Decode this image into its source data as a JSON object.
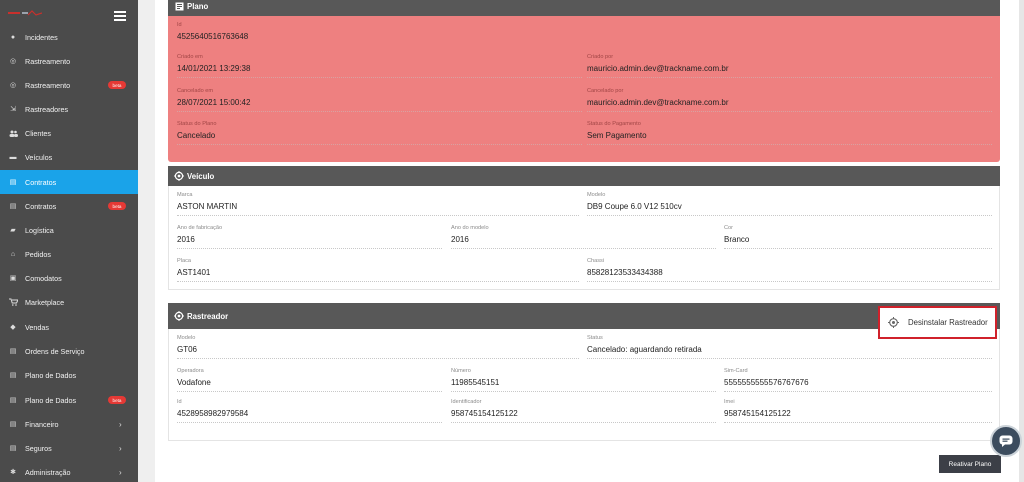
{
  "sidebar": {
    "items": [
      {
        "label": "Incidentes",
        "icon": "alert-icon",
        "glyph": "●"
      },
      {
        "label": "Rastreamento",
        "icon": "target-icon",
        "glyph": "◎"
      },
      {
        "label": "Rastreamento",
        "icon": "target-icon",
        "glyph": "◎",
        "badge": "beta"
      },
      {
        "label": "Rastreadores",
        "icon": "signin-icon",
        "glyph": "⇲"
      },
      {
        "label": "Clientes",
        "icon": "users-icon",
        "glyph": "👥"
      },
      {
        "label": "Veículos",
        "icon": "car-icon",
        "glyph": "▬"
      },
      {
        "label": "Contratos",
        "icon": "document-icon",
        "glyph": "▤",
        "active": true
      },
      {
        "label": "Contratos",
        "icon": "document-icon",
        "glyph": "▤",
        "badge": "beta"
      },
      {
        "label": "Logística",
        "icon": "truck-icon",
        "glyph": "▰"
      },
      {
        "label": "Pedidos",
        "icon": "basket-icon",
        "glyph": "⌂"
      },
      {
        "label": "Comodatos",
        "icon": "box-icon",
        "glyph": "▣"
      },
      {
        "label": "Marketplace",
        "icon": "cart-icon",
        "glyph": "⛟"
      },
      {
        "label": "Vendas",
        "icon": "tag-icon",
        "glyph": "◆"
      },
      {
        "label": "Ordens de Serviço",
        "icon": "list-icon",
        "glyph": "▤"
      },
      {
        "label": "Plano de Dados",
        "icon": "database-icon",
        "glyph": "▤"
      },
      {
        "label": "Plano de Dados",
        "icon": "database-icon",
        "glyph": "▤",
        "badge": "beta"
      },
      {
        "label": "Financeiro",
        "icon": "money-icon",
        "glyph": "▤",
        "chevron": "›"
      },
      {
        "label": "Seguros",
        "icon": "shield-icon",
        "glyph": "▤",
        "chevron": "›"
      },
      {
        "label": "Administração",
        "icon": "gear-icon",
        "glyph": "✱",
        "chevron": "›"
      }
    ]
  },
  "plano": {
    "title": "Plano",
    "fields": [
      {
        "label": "Id",
        "value": "4525640516763648"
      },
      {
        "label": "Criado em",
        "value": "14/01/2021 13:29:38"
      },
      {
        "label": "Criado por",
        "value": "mauricio.admin.dev@trackname.com.br"
      },
      {
        "label": "Cancelado em",
        "value": "28/07/2021 15:00:42"
      },
      {
        "label": "Cancelado por",
        "value": "mauricio.admin.dev@trackname.com.br"
      },
      {
        "label": "Status do Plano",
        "value": "Cancelado"
      },
      {
        "label": "Status do Pagamento",
        "value": "Sem Pagamento"
      }
    ]
  },
  "veiculo": {
    "title": "Veículo",
    "fields": [
      {
        "label": "Marca",
        "value": "ASTON MARTIN"
      },
      {
        "label": "Modelo",
        "value": "DB9 Coupe 6.0 V12 510cv"
      },
      {
        "label": "Ano de fabricação",
        "value": "2016"
      },
      {
        "label": "Ano do modelo",
        "value": "2016"
      },
      {
        "label": "Cor",
        "value": "Branco"
      },
      {
        "label": "Placa",
        "value": "AST1401"
      },
      {
        "label": "Chassi",
        "value": "85828123533434388"
      }
    ]
  },
  "rastreador": {
    "title": "Rastreador",
    "uninstall_label": "Desinstalar Rastreador",
    "fields": [
      {
        "label": "Modelo",
        "value": "GT06"
      },
      {
        "label": "Status",
        "value": "Cancelado: aguardando retirada"
      },
      {
        "label": "Operadora",
        "value": "Vodafone"
      },
      {
        "label": "Número",
        "value": "11985545151"
      },
      {
        "label": "Sim-Card",
        "value": "5555555555576767676"
      },
      {
        "label": "Id",
        "value": "4528958982979584"
      },
      {
        "label": "Identificador",
        "value": "958745154125122"
      },
      {
        "label": "Imei",
        "value": "958745154125122"
      }
    ]
  },
  "actions": {
    "reactivate_label": "Reativar Plano"
  },
  "colors": {
    "sidebar": "#4b4b4b",
    "active": "#1aa3e9",
    "plan_cancelled": "#ee8080",
    "panel_header": "#585858",
    "highlight": "#d0212b",
    "badge": "#e53935"
  }
}
